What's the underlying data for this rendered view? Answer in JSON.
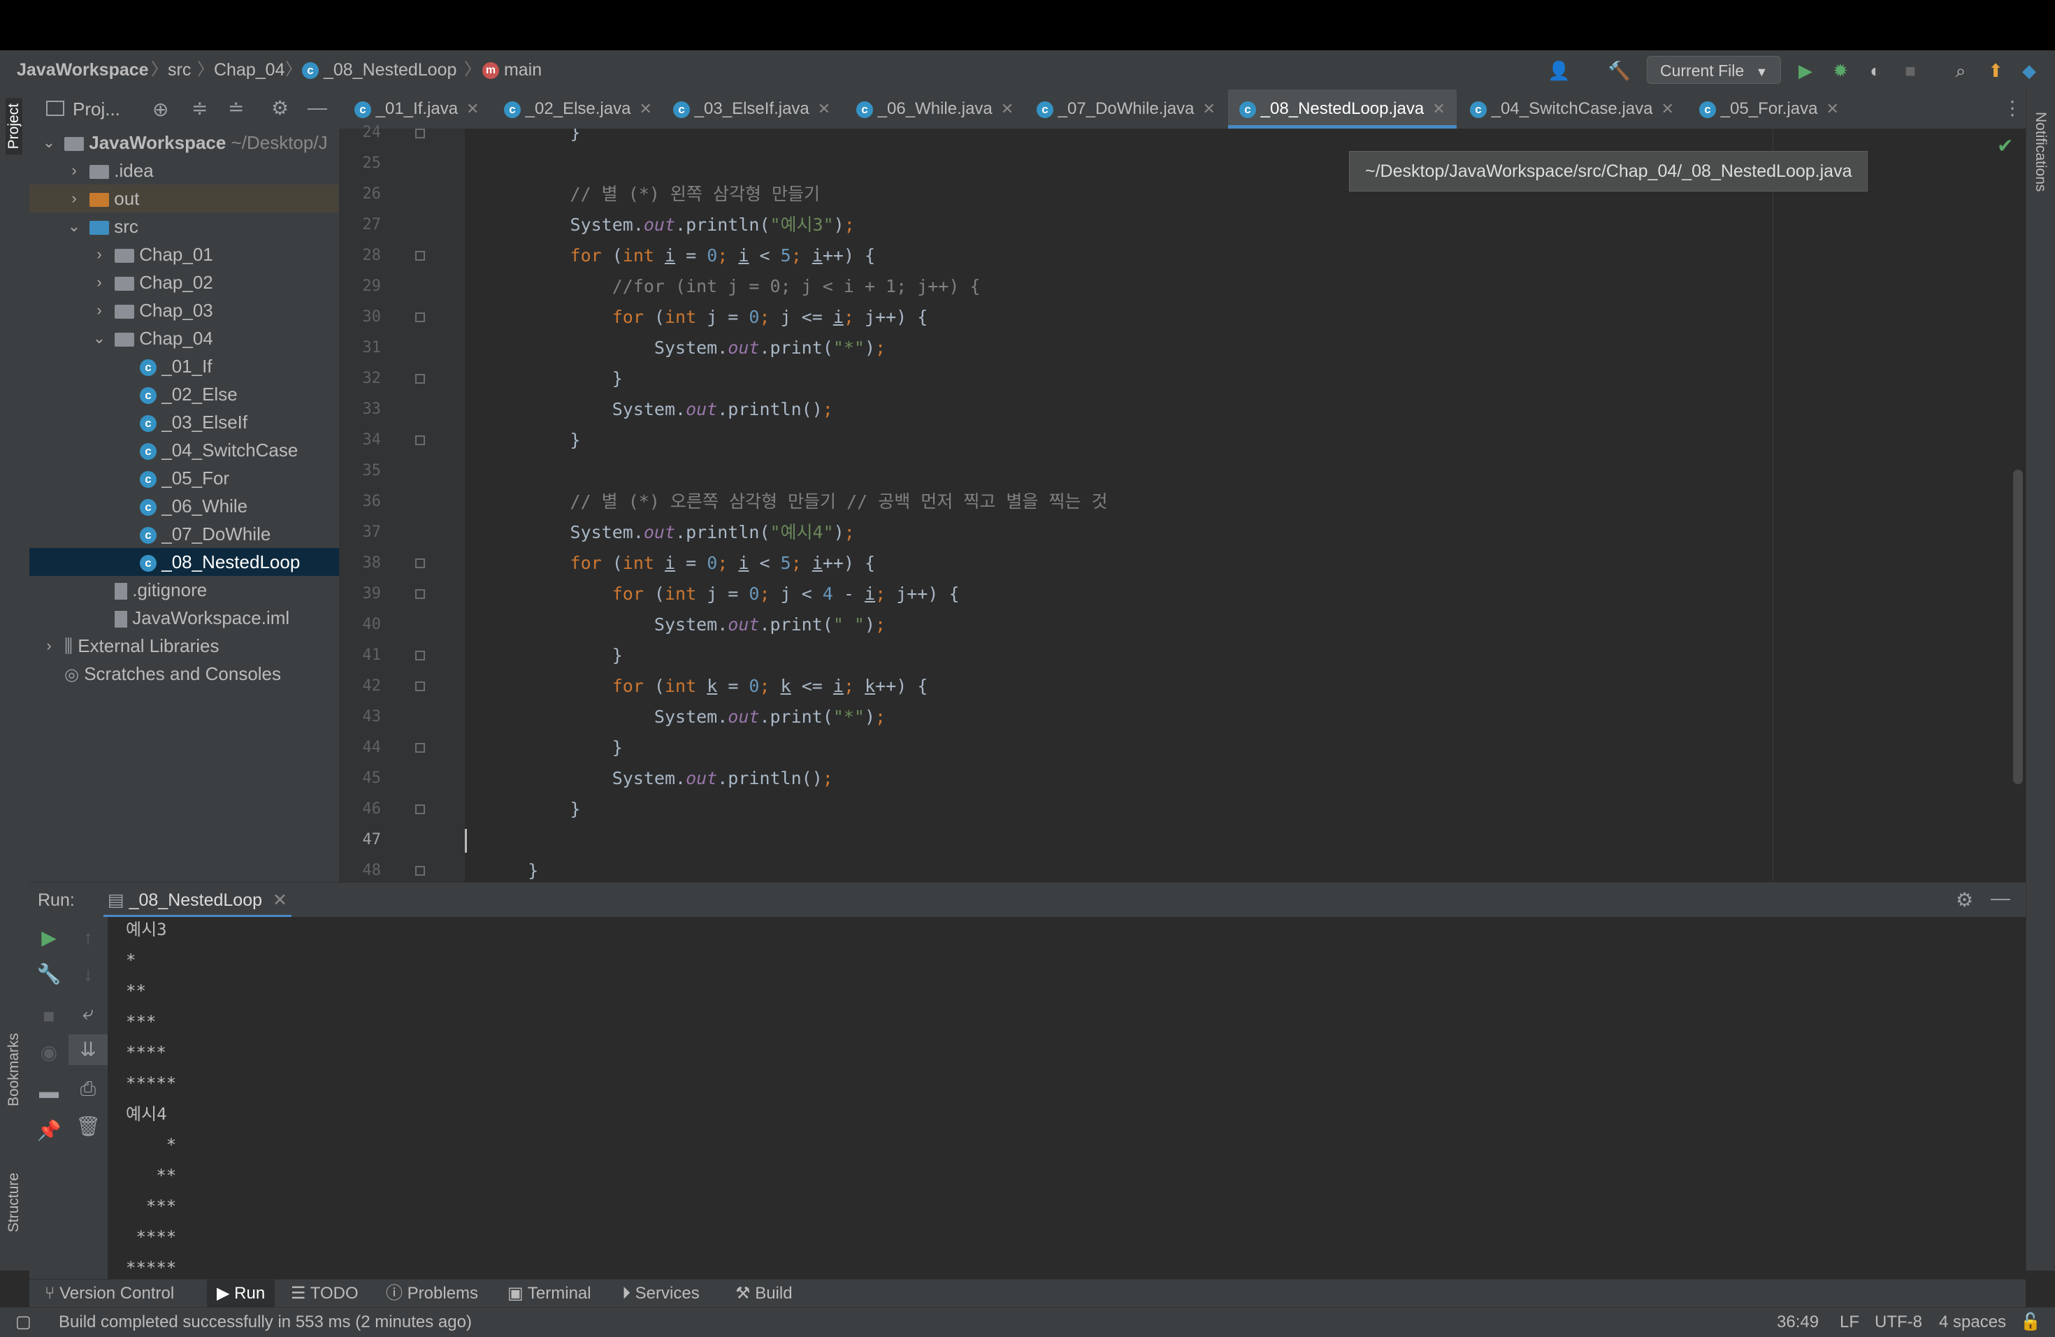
{
  "breadcrumb": {
    "project": "JavaWorkspace",
    "src": "src",
    "package": "Chap_04",
    "file": "_08_NestedLoop",
    "method": "main"
  },
  "toolbar": {
    "run_config": "Current File"
  },
  "strips": {
    "project": "Project",
    "bookmarks": "Bookmarks",
    "structure": "Structure",
    "notifications": "Notifications"
  },
  "project_panel": {
    "title": "Proj...",
    "tree": [
      {
        "label": "JavaWorkspace",
        "extra": "~/Desktop/J",
        "type": "project"
      },
      {
        "label": ".idea",
        "type": "folder"
      },
      {
        "label": "out",
        "type": "folder-orange"
      },
      {
        "label": "src",
        "type": "folder-blue"
      },
      {
        "label": "Chap_01",
        "type": "package"
      },
      {
        "label": "Chap_02",
        "type": "package"
      },
      {
        "label": "Chap_03",
        "type": "package"
      },
      {
        "label": "Chap_04",
        "type": "package"
      },
      {
        "label": "_01_If",
        "type": "class"
      },
      {
        "label": "_02_Else",
        "type": "class"
      },
      {
        "label": "_03_ElseIf",
        "type": "class"
      },
      {
        "label": "_04_SwitchCase",
        "type": "class"
      },
      {
        "label": "_05_For",
        "type": "class"
      },
      {
        "label": "_06_While",
        "type": "class"
      },
      {
        "label": "_07_DoWhile",
        "type": "class"
      },
      {
        "label": "_08_NestedLoop",
        "type": "class"
      },
      {
        "label": ".gitignore",
        "type": "file"
      },
      {
        "label": "JavaWorkspace.iml",
        "type": "file"
      },
      {
        "label": "External Libraries",
        "type": "lib"
      },
      {
        "label": "Scratches and Consoles",
        "type": "scratch"
      }
    ]
  },
  "tabs": [
    {
      "label": "_01_If.java"
    },
    {
      "label": "_02_Else.java"
    },
    {
      "label": "_03_ElseIf.java"
    },
    {
      "label": "_06_While.java"
    },
    {
      "label": "_07_DoWhile.java"
    },
    {
      "label": "_08_NestedLoop.java"
    },
    {
      "label": "_04_SwitchCase.java"
    },
    {
      "label": "_05_For.java"
    }
  ],
  "tooltip": "~/Desktop/JavaWorkspace/src/Chap_04/_08_NestedLoop.java",
  "editor": {
    "line_numbers": [
      "24",
      "25",
      "26",
      "27",
      "28",
      "29",
      "30",
      "31",
      "32",
      "33",
      "34",
      "35",
      "36",
      "37",
      "38",
      "39",
      "40",
      "41",
      "42",
      "43",
      "44",
      "45",
      "46",
      "47",
      "48"
    ],
    "current_line": "47",
    "comments": {
      "left_triangle": "// 별 (*) 왼쪽 삼각형 만들기",
      "commented_for": "//for (int j = 0; j < i + 1; j++) {",
      "right_triangle": "// 별 (*) 오른쪽 삼각형 만들기 // 공백 먼저 찍고 별을 찍는 것"
    },
    "strings": {
      "ex3": "\"예시3\"",
      "ex4": "\"예시4\"",
      "star": "\"*\"",
      "space": "\" \""
    }
  },
  "run_panel": {
    "label": "Run:",
    "tab": "_08_NestedLoop",
    "output": [
      "예시3",
      "*",
      "**",
      "***",
      "****",
      "*****",
      "예시4",
      "    *",
      "   **",
      "  ***",
      " ****",
      "*****"
    ]
  },
  "tool_tabs": [
    {
      "label": "Version Control"
    },
    {
      "label": "Run"
    },
    {
      "label": "TODO"
    },
    {
      "label": "Problems"
    },
    {
      "label": "Terminal"
    },
    {
      "label": "Services"
    },
    {
      "label": "Build"
    }
  ],
  "status": {
    "message": "Build completed successfully in 553 ms (2 minutes ago)",
    "position": "36:49",
    "line_sep": "LF",
    "encoding": "UTF-8",
    "indent": "4 spaces"
  }
}
